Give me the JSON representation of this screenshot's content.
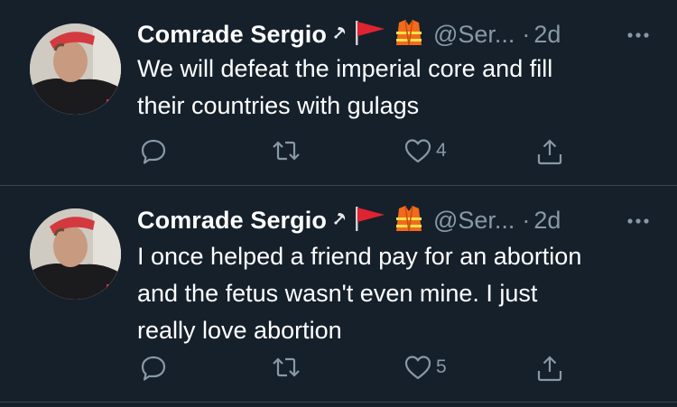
{
  "tweets": [
    {
      "author_name": "Comrade Sergio",
      "author_emojis": [
        "hammer-sickle-emoji",
        "red-flag-emoji",
        "safety-vest-emoji"
      ],
      "handle": "@Ser...",
      "separator": "·",
      "time": "2d",
      "text_lines": [
        "We will defeat the imperial core and fill",
        "their countries with gulags"
      ],
      "like_count": "4"
    },
    {
      "author_name": "Comrade Sergio",
      "author_emojis": [
        "hammer-sickle-emoji",
        "red-flag-emoji",
        "safety-vest-emoji"
      ],
      "handle": "@Ser...",
      "separator": "·",
      "time": "2d",
      "text_lines": [
        "I once helped a friend pay for an abortion",
        "and the fetus wasn't even mine. I just",
        "really love abortion"
      ],
      "like_count": "5"
    }
  ],
  "colors": {
    "background": "#15202b",
    "text_primary": "#ffffff",
    "text_secondary": "#8899a6",
    "divider": "#38444d"
  }
}
